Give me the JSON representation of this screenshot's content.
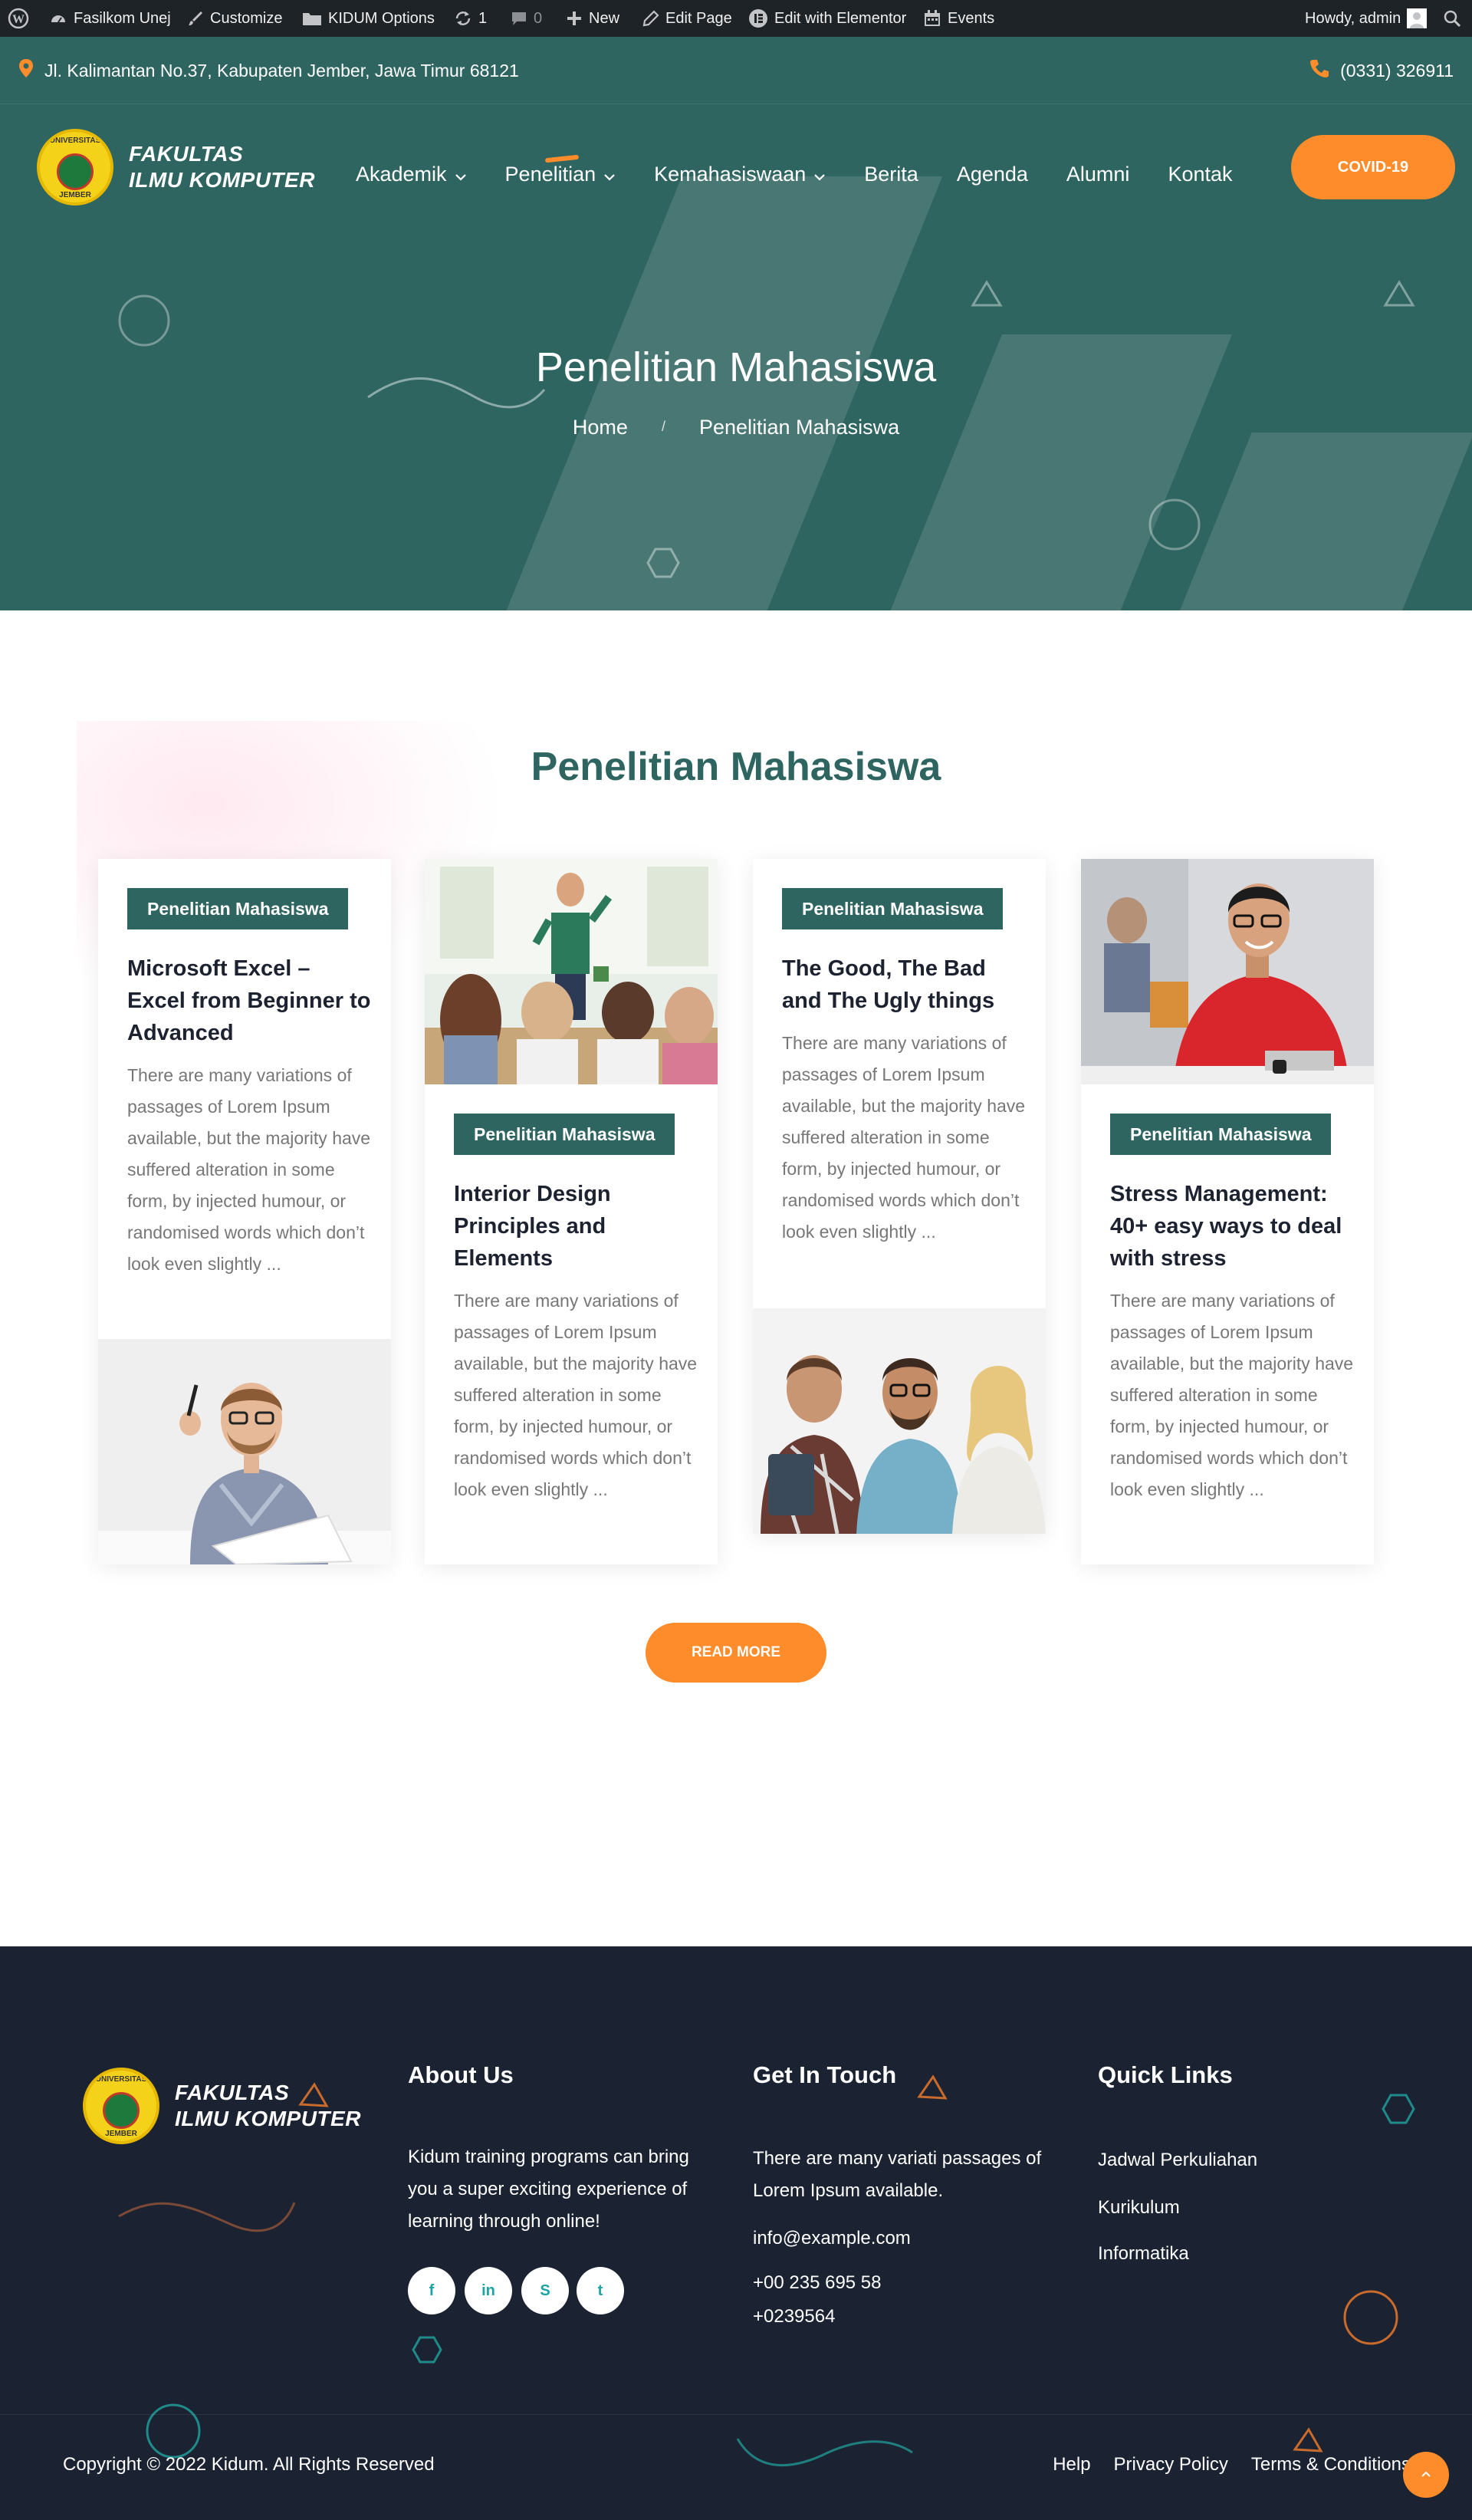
{
  "admin_bar": {
    "site_name": "Fasilkom Unej",
    "customize": "Customize",
    "options": "KIDUM Options",
    "updates_count": "1",
    "comments_count": "0",
    "new": "New",
    "edit_page": "Edit Page",
    "edit_elementor": "Edit with Elementor",
    "events": "Events",
    "howdy": "Howdy, admin"
  },
  "topbar": {
    "address": "Jl. Kalimantan No.37, Kabupaten Jember, Jawa Timur 68121",
    "phone": "(0331) 326911"
  },
  "header": {
    "logo_line1": "FAKULTAS",
    "logo_line2": "ILMU KOMPUTER",
    "emblem_top": "UNIVERSITAS",
    "emblem_bottom": "JEMBER",
    "nav": {
      "akademik": "Akademik",
      "penelitian": "Penelitian",
      "kemahasiswaan": "Kemahasiswaan",
      "berita": "Berita",
      "agenda": "Agenda",
      "alumni": "Alumni",
      "kontak": "Kontak"
    },
    "cta": "COVID-19"
  },
  "hero": {
    "title": "Penelitian Mahasiswa",
    "breadcrumb_home": "Home",
    "breadcrumb_sep": "/",
    "breadcrumb_current": "Penelitian Mahasiswa"
  },
  "section": {
    "title": "Penelitian Mahasiswa",
    "read_more": "READ MORE"
  },
  "posts": [
    {
      "category": "Penelitian Mahasiswa",
      "title": "Microsoft Excel – Excel from Beginner to Advanced",
      "excerpt": "There are many variations of passages of Lorem Ipsum available, but the majority have suffered alteration in some form, by injected humour, or randomised words which don’t look even slightly ..."
    },
    {
      "category": "Penelitian Mahasiswa",
      "title": "Interior Design Principles and Elements",
      "excerpt": "There are many variations of passages of Lorem Ipsum available, but the majority have suffered alteration in some form, by injected humour, or randomised words which don’t look even slightly ..."
    },
    {
      "category": "Penelitian Mahasiswa",
      "title": "The Good, The Bad and The Ugly things",
      "excerpt": "There are many variations of passages of Lorem Ipsum available, but the majority have suffered alteration in some form, by injected humour, or randomised words which don’t look even slightly ..."
    },
    {
      "category": "Penelitian Mahasiswa",
      "title": "Stress Management: 40+ easy ways to deal with stress",
      "excerpt": "There are many variations of passages of Lorem Ipsum available, but the majority have suffered alteration in some form, by injected humour, or randomised words which don’t look even slightly ..."
    }
  ],
  "footer": {
    "logo_line1": "FAKULTAS",
    "logo_line2": "ILMU KOMPUTER",
    "about_title": "About Us",
    "about_text": "Kidum training programs can bring you a super exciting experience of learning through online!",
    "contact_title": "Get In Touch",
    "contact_text": "There are many variati passages of Lorem Ipsum available.",
    "email": "info@example.com",
    "phone1": "+00 235 695 58",
    "phone2": "+0239564",
    "links_title": "Quick Links",
    "links": {
      "jadwal": "Jadwal Perkuliahan",
      "kurikulum": "Kurikulum",
      "informatika": "Informatika"
    },
    "social": {
      "facebook": "f",
      "linkedin": "in",
      "skype": "S",
      "twitter": "t"
    },
    "copyright": "Copyright © 2022 Kidum. All Rights Reserved",
    "bottom_links": {
      "help": "Help",
      "privacy": "Privacy Policy",
      "terms": "Terms & Conditions"
    }
  },
  "colors": {
    "primary": "#2e6560",
    "accent": "#ff8c2b",
    "footer_bg": "#1b2232",
    "admin_bar": "#1d2327"
  }
}
